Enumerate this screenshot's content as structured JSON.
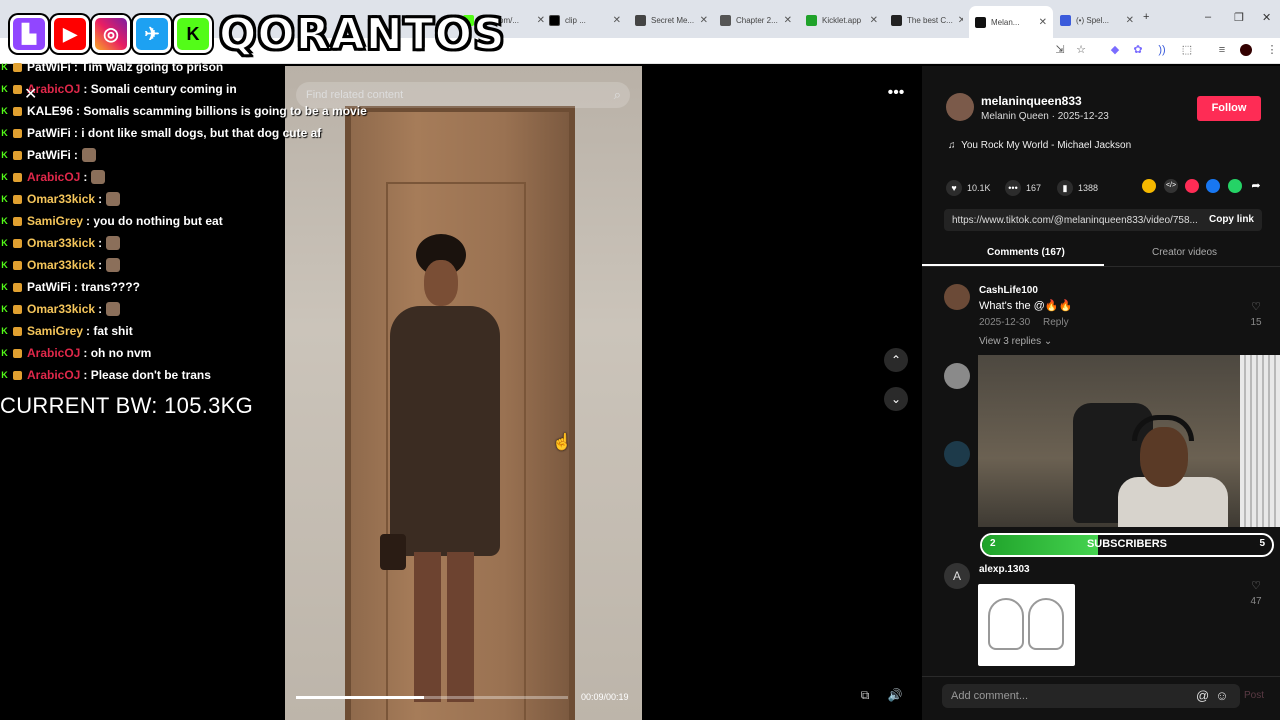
{
  "browser": {
    "tabs": [
      {
        "label": "kick.com/...",
        "color": "#53fc18"
      },
      {
        "label": "clip ...",
        "color": "#000000"
      },
      {
        "label": "Secret Me...",
        "color": "#444444"
      },
      {
        "label": "Chapter 2...",
        "color": "#555555"
      },
      {
        "label": "Kicklet.app",
        "color": "#1fa22a"
      },
      {
        "label": "The best C...",
        "color": "#222222"
      },
      {
        "label": "Melan...",
        "color": "#111111"
      },
      {
        "label": "(•) Spel...",
        "color": "#3b5bdb"
      }
    ],
    "active_tab_index": 6
  },
  "overlay": {
    "brand": "QORANTOS",
    "close_glyph": "✕",
    "weight_text": "CURRENT BW: 105.3KG",
    "chat": [
      {
        "user": "PatWiFi",
        "color": "#ffffff",
        "text": ": Tim Walz going to prison"
      },
      {
        "user": "ArabicOJ",
        "color": "#e0284a",
        "text": ": Somali century coming in"
      },
      {
        "user": "KALE96",
        "color": "#ffffff",
        "text": ": Somalis scamming billions is going to be a movie"
      },
      {
        "user": "PatWiFi",
        "color": "#ffffff",
        "text": ": i dont like small dogs, but that dog cute af"
      },
      {
        "user": "PatWiFi",
        "color": "#ffffff",
        "text": ":"
      },
      {
        "user": "ArabicOJ",
        "color": "#e0284a",
        "text": ":"
      },
      {
        "user": "Omar33kick",
        "color": "#f4c55a",
        "text": ":"
      },
      {
        "user": "SamiGrey",
        "color": "#f4c55a",
        "text": ": you do nothing but eat"
      },
      {
        "user": "Omar33kick",
        "color": "#f4c55a",
        "text": ":"
      },
      {
        "user": "Omar33kick",
        "color": "#f4c55a",
        "text": ":"
      },
      {
        "user": "PatWiFi",
        "color": "#ffffff",
        "text": ": trans????"
      },
      {
        "user": "Omar33kick",
        "color": "#f4c55a",
        "text": ":"
      },
      {
        "user": "SamiGrey",
        "color": "#f4c55a",
        "text": ": fat shit"
      },
      {
        "user": "ArabicOJ",
        "color": "#e0284a",
        "text": ": oh no nvm"
      },
      {
        "user": "ArabicOJ",
        "color": "#e0284a",
        "text": ": Please don't be trans"
      }
    ]
  },
  "video": {
    "search_placeholder": "Find related content",
    "timecode": "00:09/00:19",
    "progress": 0.47
  },
  "post": {
    "username": "melaninqueen833",
    "subline": "Melanin Queen · 2025-12-23",
    "follow_label": "Follow",
    "music": "You Rock My World - Michael Jackson",
    "likes": "10.1K",
    "comments": "167",
    "saves": "1388",
    "link": "https://www.tiktok.com/@melaninqueen833/video/758...",
    "copy_label": "Copy link",
    "tab_comments": "Comments (167)",
    "tab_creator": "Creator videos",
    "share_colors": [
      "#f5b800",
      "#333333",
      "#fe2c55",
      "#1877f2",
      "#25d366",
      "#444444"
    ]
  },
  "comments": [
    {
      "user": "CashLife100",
      "text": "What's the @🔥🔥",
      "date": "2025-12-30",
      "reply": "Reply",
      "likes": "15",
      "view_replies": "View 3 replies ⌄"
    },
    {
      "user": "alexp.1303",
      "text": "",
      "date": "",
      "reply": "",
      "likes": "47",
      "avatar_letter": "A"
    }
  ],
  "subgoal": {
    "left": "2",
    "label": "SUBSCRIBERS",
    "right": "5",
    "progress": 0.4
  },
  "comment_input": {
    "placeholder": "Add comment...",
    "post_label": "Post"
  }
}
